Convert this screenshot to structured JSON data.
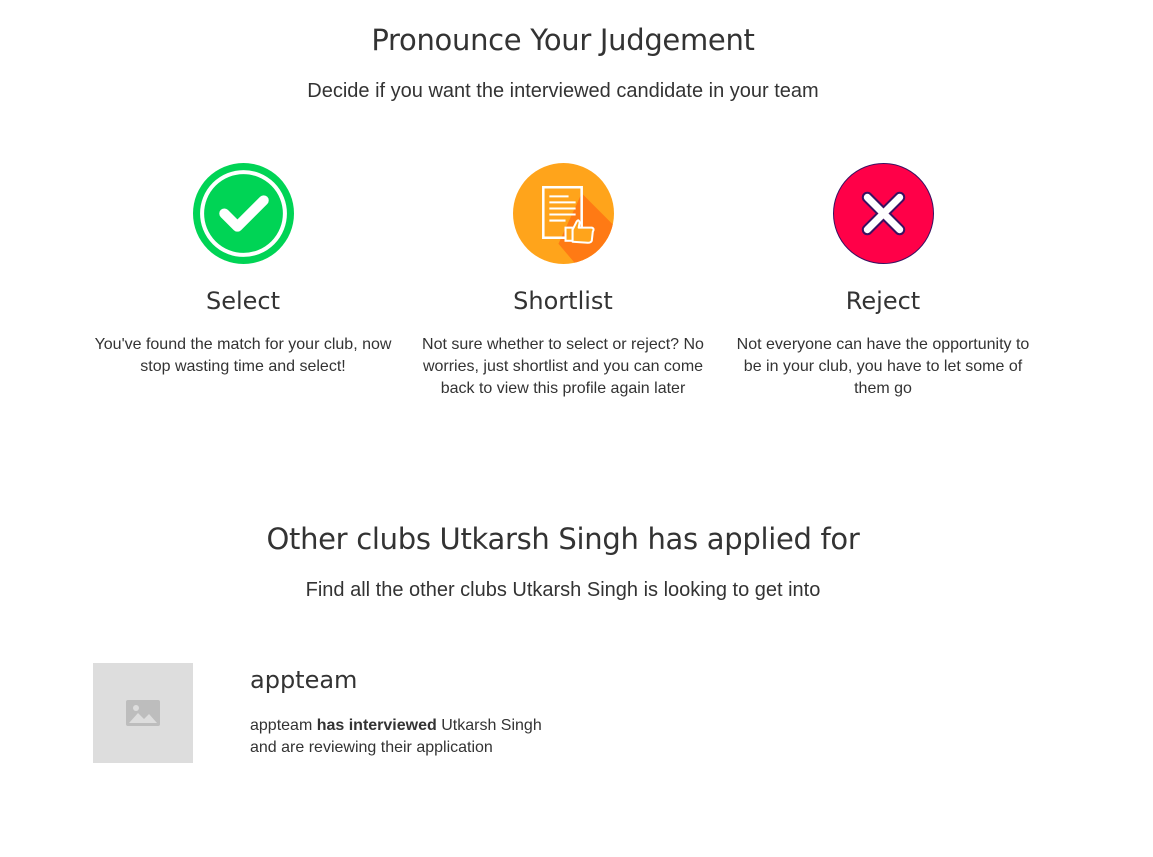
{
  "judgement": {
    "title": "Pronounce Your Judgement",
    "subtitle": "Decide if you want the interviewed candidate in your team",
    "options": [
      {
        "icon": "check-circle-icon",
        "title": "Select",
        "description": "You've found the match for your club, now stop wasting time and select!",
        "color": "#00d455"
      },
      {
        "icon": "shortlist-document-thumbs-up-icon",
        "title": "Shortlist",
        "description": "Not sure whether to select or reject? No worries, just shortlist and you can come back to view this profile again later",
        "color": "#ffa41b"
      },
      {
        "icon": "reject-x-icon",
        "title": "Reject",
        "description": "Not everyone can have the opportunity to be in your club, you have to let some of them go",
        "color": "#ff0048"
      }
    ]
  },
  "other_clubs": {
    "title": "Other clubs Utkarsh Singh has applied for",
    "subtitle": "Find all the other clubs Utkarsh Singh is looking to get into",
    "clubs": [
      {
        "name": "appteam",
        "thumbnail_icon": "image-placeholder-icon",
        "status_prefix": "appteam",
        "status_bold": "has interviewed",
        "status_suffix": "Utkarsh Singh",
        "status_line2": "and are reviewing their application"
      }
    ]
  }
}
